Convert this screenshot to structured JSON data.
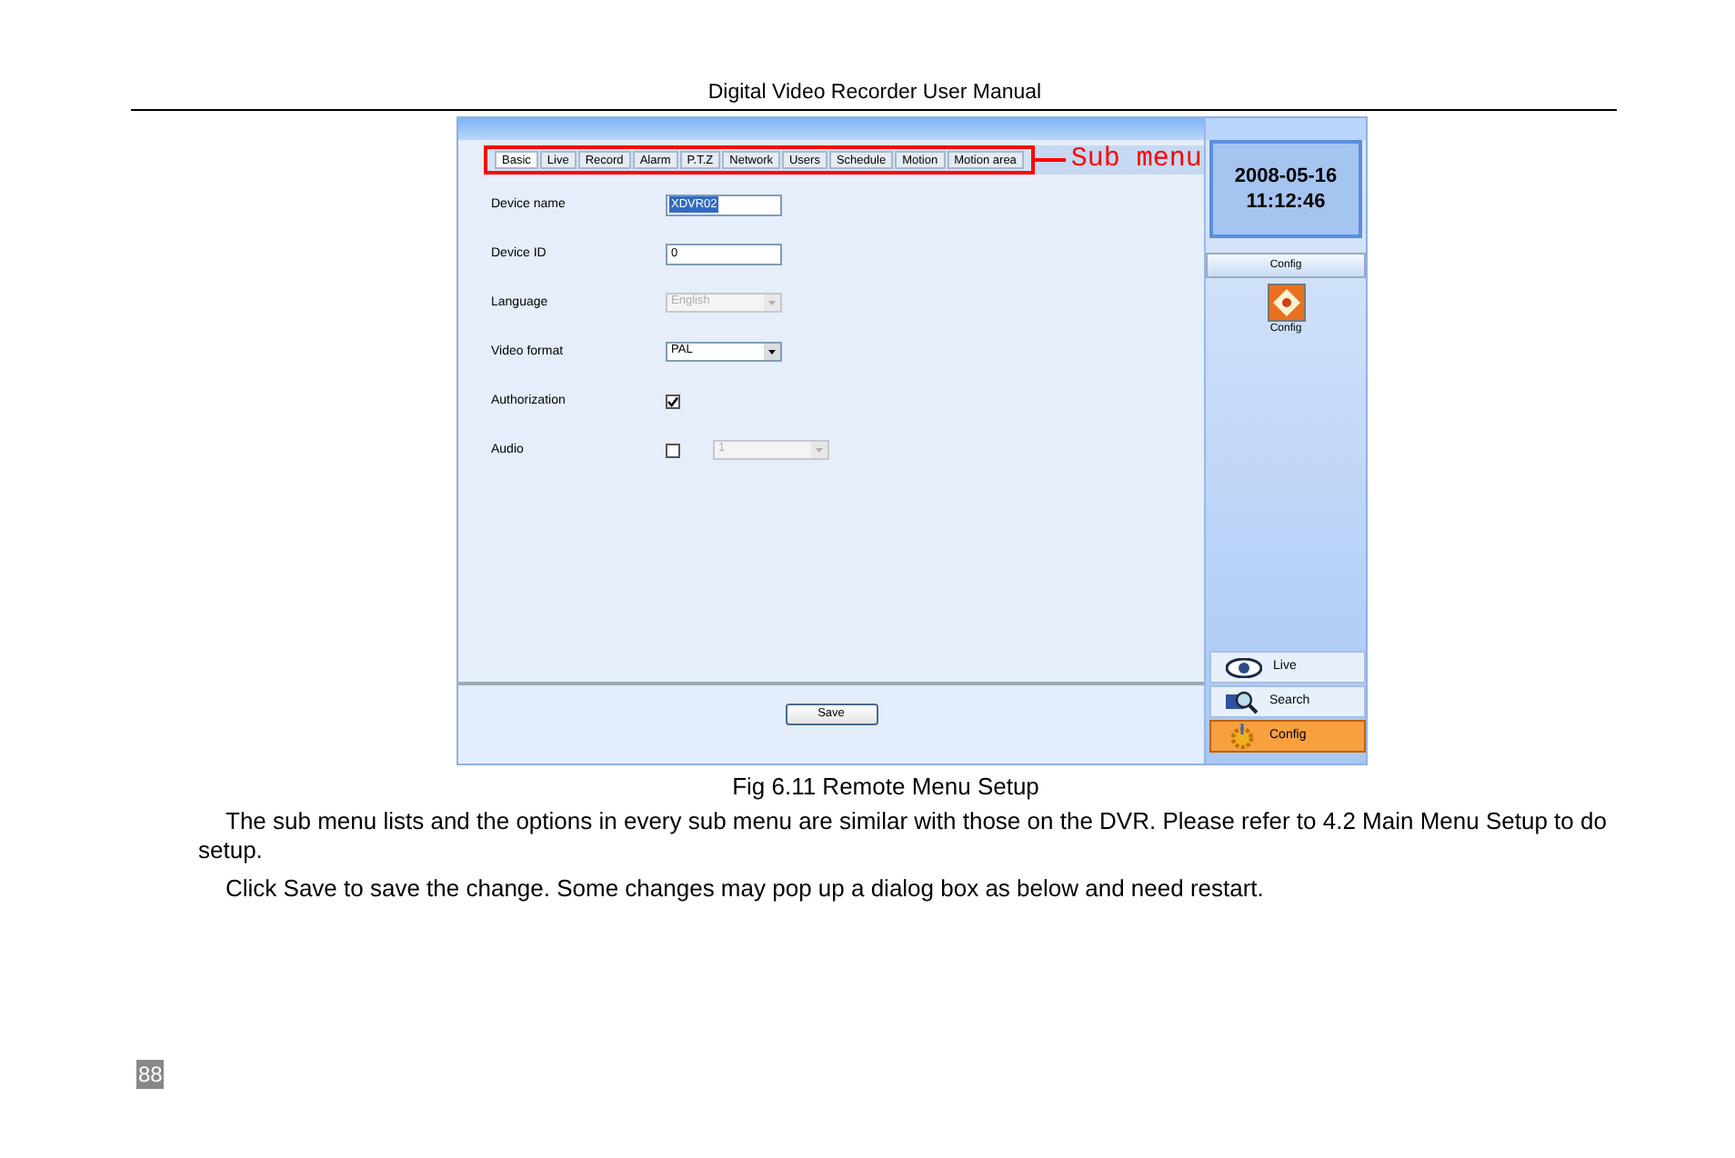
{
  "header": {
    "title": "Digital Video Recorder User Manual"
  },
  "screenshot": {
    "tabs": [
      {
        "label": "Basic",
        "selected": true
      },
      {
        "label": "Live",
        "selected": false
      },
      {
        "label": "Record",
        "selected": false
      },
      {
        "label": "Alarm",
        "selected": false
      },
      {
        "label": "P.T.Z",
        "selected": false
      },
      {
        "label": "Network",
        "selected": false
      },
      {
        "label": "Users",
        "selected": false
      },
      {
        "label": "Schedule",
        "selected": false
      },
      {
        "label": "Motion",
        "selected": false
      },
      {
        "label": "Motion area",
        "selected": false
      }
    ],
    "annotation": "Sub menu",
    "fields": [
      {
        "kind": "text",
        "label": "Device name",
        "value": "XDVR02",
        "highlighted": true
      },
      {
        "kind": "text",
        "label": "Device ID",
        "value": "0",
        "highlighted": false
      },
      {
        "kind": "select",
        "label": "Language",
        "value": "English",
        "disabled": true
      },
      {
        "kind": "select",
        "label": "Video format",
        "value": "PAL",
        "disabled": false
      },
      {
        "kind": "checkbox",
        "label": "Authorization",
        "checked": true
      },
      {
        "kind": "checkbox_select",
        "label": "Audio",
        "checked": false,
        "value": "1",
        "disabled": true
      }
    ],
    "save_button": "Save",
    "clock": {
      "date": "2008-05-16",
      "time": "11:12:46"
    },
    "panel_title": "Config",
    "panel_icon_label": "Config",
    "nav": [
      {
        "label": "Live",
        "kind": "eye",
        "selected": false
      },
      {
        "label": "Search",
        "kind": "search",
        "selected": false
      },
      {
        "label": "Config",
        "kind": "gear",
        "selected": true
      }
    ]
  },
  "caption": "Fig 6.11 Remote Menu Setup",
  "paragraphs": [
    "The sub menu lists and the options in every sub menu are similar with those on the DVR. Please refer to 4.2 Main Menu Setup to do setup.",
    "Click Save to save the change. Some changes may pop up a dialog box as below and need restart."
  ],
  "page_number": "88"
}
